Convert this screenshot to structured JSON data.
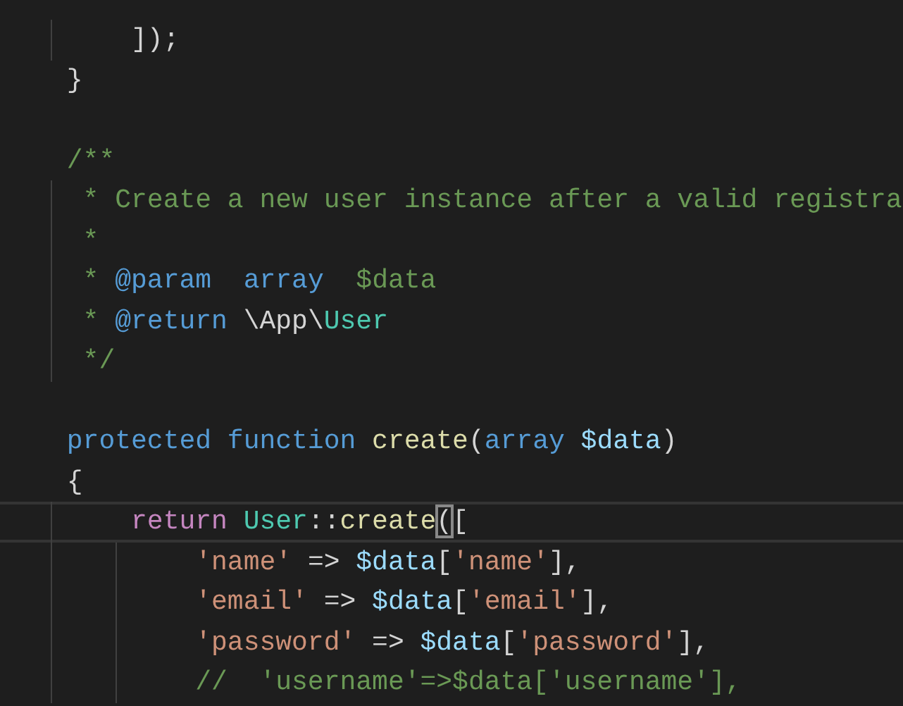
{
  "editor": {
    "lines": [
      {
        "current": false,
        "tokens": [
          {
            "kind": "plain",
            "text": "    ]);"
          }
        ]
      },
      {
        "current": false,
        "tokens": [
          {
            "kind": "plain",
            "text": "}"
          }
        ]
      },
      {
        "kind": "blank"
      },
      {
        "current": false,
        "tokens": [
          {
            "kind": "comment",
            "text": "/**"
          }
        ]
      },
      {
        "current": false,
        "tokens": [
          {
            "kind": "comment",
            "text": " * Create a new user instance after a valid registra"
          }
        ]
      },
      {
        "current": false,
        "tokens": [
          {
            "kind": "comment",
            "text": " *"
          }
        ]
      },
      {
        "current": false,
        "tokens": [
          {
            "kind": "comment",
            "text": " * "
          },
          {
            "kind": "keyword",
            "text": "@param  array"
          },
          {
            "kind": "comment",
            "text": "  $data"
          }
        ]
      },
      {
        "current": false,
        "tokens": [
          {
            "kind": "comment",
            "text": " * "
          },
          {
            "kind": "keyword",
            "text": "@return"
          },
          {
            "kind": "plain",
            "text": " \\App\\"
          },
          {
            "kind": "class",
            "text": "User"
          }
        ]
      },
      {
        "current": false,
        "tokens": [
          {
            "kind": "comment",
            "text": " */"
          }
        ]
      },
      {
        "kind": "blank"
      },
      {
        "current": false,
        "tokens": [
          {
            "kind": "keyword",
            "text": "protected function "
          },
          {
            "kind": "function",
            "text": "create"
          },
          {
            "kind": "plain",
            "text": "("
          },
          {
            "kind": "keyword",
            "text": "array "
          },
          {
            "kind": "variable",
            "text": "$data"
          },
          {
            "kind": "plain",
            "text": ")"
          }
        ]
      },
      {
        "current": false,
        "tokens": [
          {
            "kind": "plain",
            "text": "{"
          }
        ]
      },
      {
        "current": true,
        "tokens": [
          {
            "kind": "control",
            "text": "    return "
          },
          {
            "kind": "class",
            "text": "User"
          },
          {
            "kind": "plain",
            "text": "::"
          },
          {
            "kind": "function",
            "text": "create"
          },
          {
            "kind": "bracket-match",
            "text": "("
          },
          {
            "kind": "plain",
            "text": "["
          }
        ]
      },
      {
        "current": false,
        "tokens": [
          {
            "kind": "string",
            "text": "        'name'"
          },
          {
            "kind": "plain",
            "text": " => "
          },
          {
            "kind": "variable",
            "text": "$data"
          },
          {
            "kind": "plain",
            "text": "["
          },
          {
            "kind": "string",
            "text": "'name'"
          },
          {
            "kind": "plain",
            "text": "],"
          }
        ]
      },
      {
        "current": false,
        "tokens": [
          {
            "kind": "string",
            "text": "        'email'"
          },
          {
            "kind": "plain",
            "text": " => "
          },
          {
            "kind": "variable",
            "text": "$data"
          },
          {
            "kind": "plain",
            "text": "["
          },
          {
            "kind": "string",
            "text": "'email'"
          },
          {
            "kind": "plain",
            "text": "],"
          }
        ]
      },
      {
        "current": false,
        "tokens": [
          {
            "kind": "string",
            "text": "        'password'"
          },
          {
            "kind": "plain",
            "text": " => "
          },
          {
            "kind": "variable",
            "text": "$data"
          },
          {
            "kind": "plain",
            "text": "["
          },
          {
            "kind": "string",
            "text": "'password'"
          },
          {
            "kind": "plain",
            "text": "],"
          }
        ]
      },
      {
        "current": false,
        "tokens": [
          {
            "kind": "comment",
            "text": "        //  'username'=>$data['username'],"
          }
        ]
      }
    ]
  }
}
